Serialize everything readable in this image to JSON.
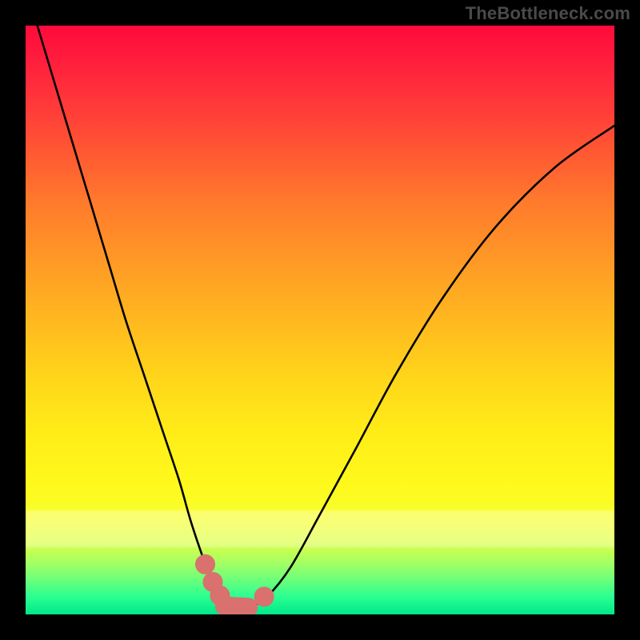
{
  "watermark": "TheBottleneck.com",
  "colors": {
    "marker": "#d9716e",
    "curve": "#000000",
    "frame_bg": "#000000"
  },
  "chart_data": {
    "type": "line",
    "title": "",
    "xlabel": "",
    "ylabel": "",
    "xlim": [
      0,
      100
    ],
    "ylim": [
      0,
      100
    ],
    "grid": false,
    "legend": false,
    "series": [
      {
        "name": "bottleneck-curve",
        "x": [
          2,
          5,
          8,
          11,
          14,
          17,
          20,
          23,
          26,
          28,
          30,
          31.5,
          33,
          34.5,
          36,
          38,
          41,
          45,
          50,
          56,
          63,
          71,
          80,
          90,
          100
        ],
        "y": [
          100,
          90,
          80,
          70,
          60,
          50,
          41,
          32,
          23,
          16,
          10,
          6,
          3,
          1.5,
          0.8,
          1.2,
          3,
          8,
          17,
          28,
          41,
          54,
          66,
          76,
          83
        ]
      }
    ],
    "annotations": {
      "markers": [
        {
          "type": "dot",
          "x": 30.5,
          "y": 8.5
        },
        {
          "type": "dot",
          "x": 31.8,
          "y": 5.5
        },
        {
          "type": "dot",
          "x": 33.0,
          "y": 3.2
        },
        {
          "type": "capsule",
          "x_start": 33.8,
          "y_start": 1.4,
          "x_end": 37.8,
          "y_end": 1.2
        },
        {
          "type": "dot",
          "x": 40.5,
          "y": 3.0
        }
      ]
    }
  }
}
